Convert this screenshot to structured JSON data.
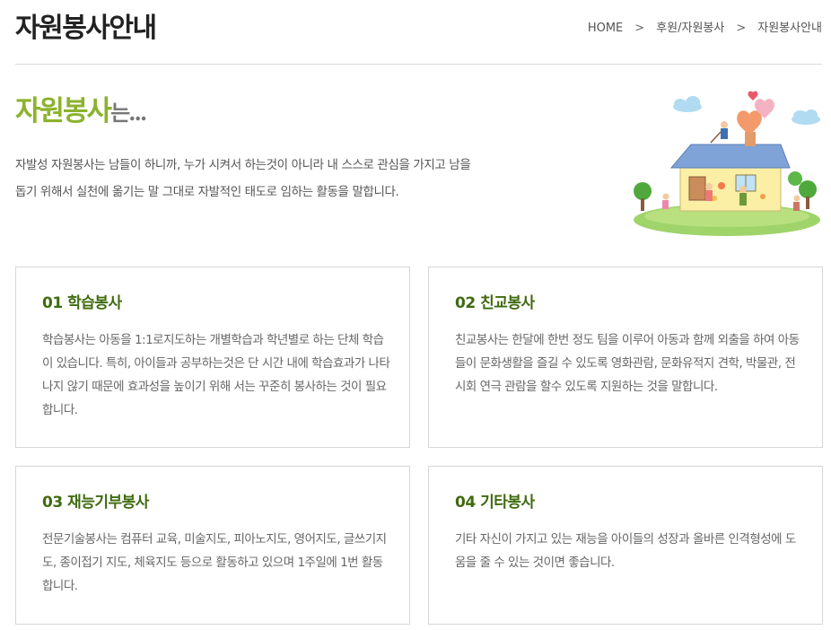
{
  "page": {
    "title": "자원봉사안내"
  },
  "breadcrumb": {
    "home": "HOME",
    "level1": "후원/자원봉사",
    "level2": "자원봉사안내",
    "separator": ">"
  },
  "intro": {
    "heading_main": "자원봉사",
    "heading_suffix": "는...",
    "text": "자발성 자원봉사는 남들이 하니까, 누가 시켜서 하는것이 아니라 내 스스로 관심을 가지고 남을 돕기 위해서 실천에 옮기는 말 그대로 자발적인 태도로 임하는 활동을 말합니다.",
    "illustration_icon": "house-volunteers-illustration"
  },
  "cards": [
    {
      "title": "01 학습봉사",
      "text": "학습봉사는 아동을 1:1로지도하는 개별학습과 학년별로 하는 단체 학습이 있습니다. 특히, 아이들과 공부하는것은 단 시간 내에 학습효과가 나타나지 않기 때문에 효과성을 높이기 위해 서는 꾸준히 봉사하는 것이 필요합니다."
    },
    {
      "title": "02 친교봉사",
      "text": "친교봉사는 한달에 한번 정도 팀을 이루어 아동과 함께 외출을 하여 아동들이 문화생활을 즐길 수 있도록 영화관람, 문화유적지 견학, 박물관, 전시회 연극 관람을 할수 있도록 지원하는 것을 말합니다."
    },
    {
      "title": "03 재능기부봉사",
      "text": "전문기술봉사는 컴퓨터 교육, 미술지도, 피아노지도, 영어지도, 글쓰기지도, 종이접기 지도, 체육지도 등으로 활동하고 있으며 1주일에 1번 활동합니다."
    },
    {
      "title": "04 기타봉사",
      "text": "기타 자신이 가지고 있는 재능을 아이들의 성장과 올바른 인격형성에 도움을 줄 수 있는 것이면 좋습니다."
    }
  ],
  "colors": {
    "accent_green": "#8cb22e",
    "title_green": "#3f6b0f",
    "border": "#d6d6d6"
  }
}
